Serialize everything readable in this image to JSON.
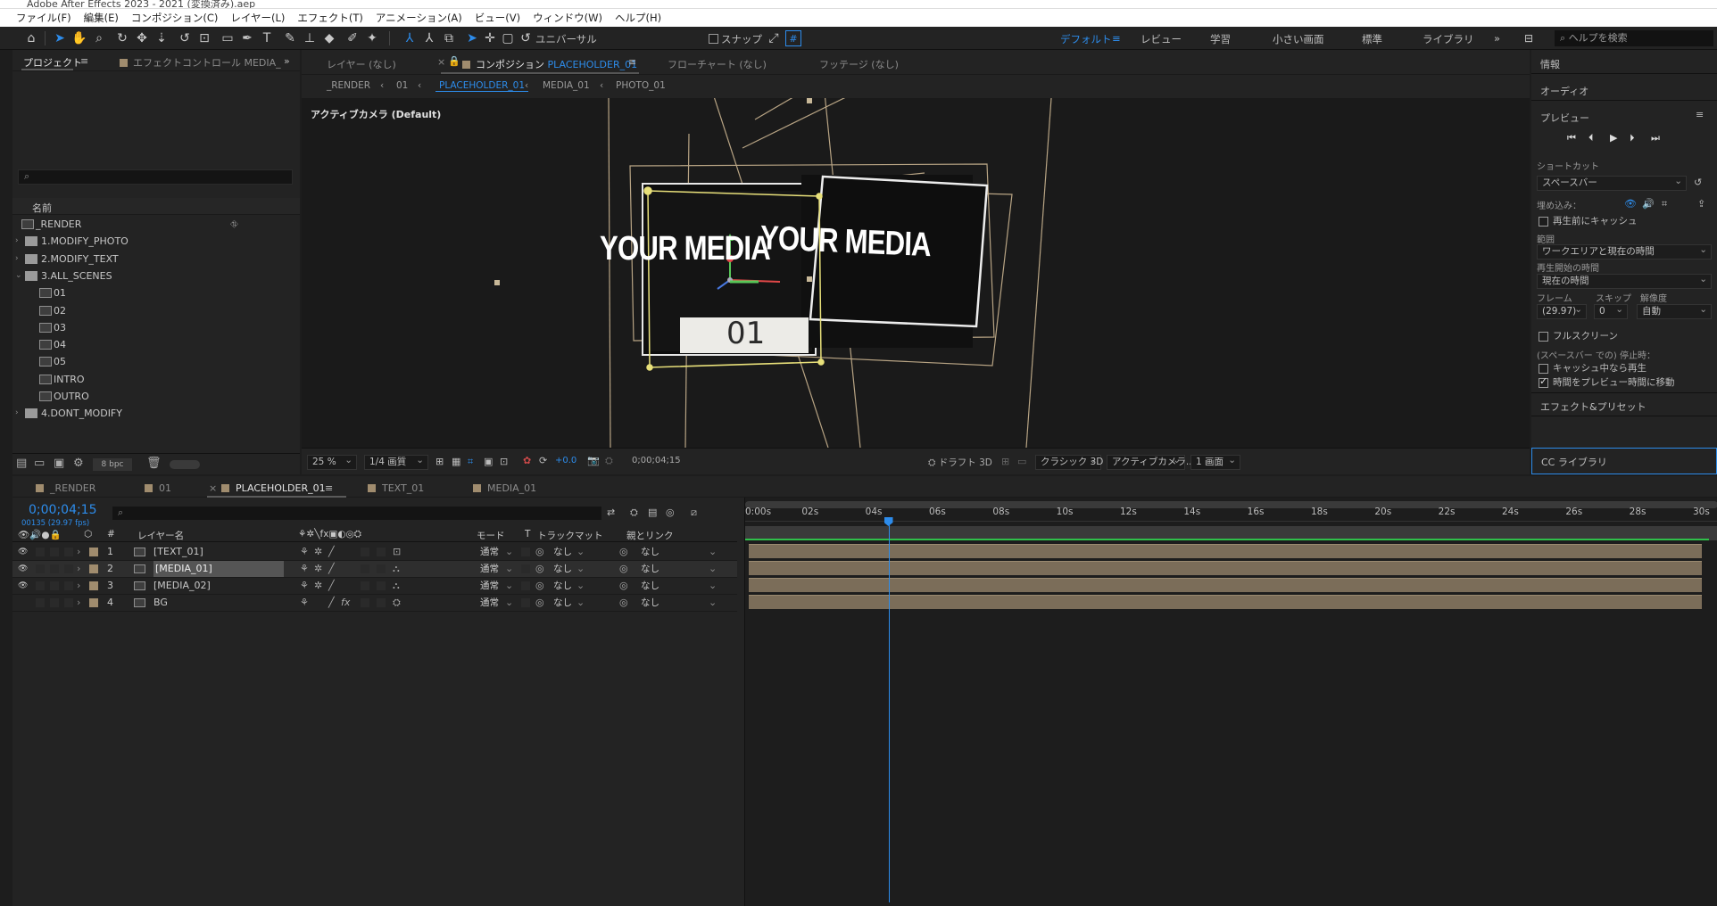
{
  "app": {
    "title": "Adobe After Effects 2023 - 2021 (変換済み).aep",
    "menu": [
      "ファイル(F)",
      "編集(E)",
      "コンポジション(C)",
      "レイヤー(L)",
      "エフェクト(T)",
      "アニメーション(A)",
      "ビュー(V)",
      "ウィンドウ(W)",
      "ヘルプ(H)"
    ]
  },
  "toolbar": {
    "universal": "ユニバーサル",
    "snap": "スナップ",
    "workspaces": [
      "デフォルト",
      "レビュー",
      "学習",
      "小さい画面",
      "標準",
      "ライブラリ"
    ],
    "active_workspace": "デフォルト",
    "search_placeholder": "ヘルプを検索"
  },
  "project": {
    "tabs": [
      "プロジェクト",
      "エフェクトコントロール MEDIA_"
    ],
    "search_placeholder": "",
    "column_name": "名前",
    "items": [
      {
        "label": "_RENDER",
        "type": "comp",
        "indent": 0
      },
      {
        "label": "1.MODIFY_PHOTO",
        "type": "folder",
        "indent": 0,
        "collapsed": true
      },
      {
        "label": "2.MODIFY_TEXT",
        "type": "folder",
        "indent": 0,
        "collapsed": true
      },
      {
        "label": "3.ALL_SCENES",
        "type": "folder",
        "indent": 0,
        "collapsed": false
      },
      {
        "label": "01",
        "type": "comp",
        "indent": 1
      },
      {
        "label": "02",
        "type": "comp",
        "indent": 1
      },
      {
        "label": "03",
        "type": "comp",
        "indent": 1
      },
      {
        "label": "04",
        "type": "comp",
        "indent": 1
      },
      {
        "label": "05",
        "type": "comp",
        "indent": 1
      },
      {
        "label": "INTRO",
        "type": "comp",
        "indent": 1
      },
      {
        "label": "OUTRO",
        "type": "comp",
        "indent": 1
      },
      {
        "label": "4.DONT_MODIFY",
        "type": "folder",
        "indent": 0,
        "collapsed": true
      }
    ],
    "bpc": "8 bpc"
  },
  "viewer": {
    "tabs": {
      "layer": "レイヤー (なし)",
      "comp_prefix": "コンポジション",
      "comp_name": "PLACEHOLDER_01",
      "flowchart": "フローチャート (なし)",
      "footage": "フッテージ (なし)"
    },
    "breadcrumbs": [
      "_RENDER",
      "01",
      "PLACEHOLDER_01",
      "MEDIA_01",
      "PHOTO_01"
    ],
    "active_breadcrumb": "PLACEHOLDER_01",
    "camera_label": "アクティブカメラ (Default)",
    "card_text_1": "YOUR MEDIA",
    "card_text_2": "YOUR MEDIA",
    "card_number": "01",
    "footer": {
      "zoom": "25 %",
      "quality": "1/4 画質",
      "exposure": "+0.0",
      "timecode": "0;00;04;15",
      "draft3d": "ドラフト 3D",
      "renderer": "クラシック 3D",
      "camera": "アクティブカメラ...",
      "views": "1 画面"
    }
  },
  "right_panel": {
    "info": "情報",
    "audio": "オーディオ",
    "preview": "プレビュー",
    "shortcut_label": "ショートカット",
    "shortcut_value": "スペースバー",
    "include_label": "埋め込み：",
    "cache_before": "再生前にキャッシュ",
    "range_label": "範囲",
    "range_value": "ワークエリアと現在の時間",
    "play_from_label": "再生開始の時間",
    "play_from_value": "現在の時間",
    "frame_label": "フレーム",
    "skip_label": "スキップ",
    "res_label": "解像度",
    "frame_value": "(29.97)",
    "skip_value": "0",
    "res_value": "自動",
    "fullscreen": "フルスクリーン",
    "stop_label": "(スペースバー での) 停止時：",
    "cache_in_play": "キャッシュ中なら再生",
    "move_time": "時間をプレビュー時間に移動",
    "effects_presets": "エフェクト&プリセット",
    "cc_libraries": "CC ライブラリ"
  },
  "timeline": {
    "tabs": [
      "_RENDER",
      "01",
      "PLACEHOLDER_01",
      "TEXT_01",
      "MEDIA_01"
    ],
    "active_tab": "PLACEHOLDER_01",
    "current_time": "0;00;04;15",
    "frame_info": "00135 (29.97 fps)",
    "columns": {
      "num": "#",
      "name": "レイヤー名",
      "mode": "モード",
      "t": "T",
      "matte": "トラックマット",
      "parent": "親とリンク"
    },
    "layers": [
      {
        "num": "1",
        "name": "[TEXT_01]",
        "mode": "通常",
        "matte": "なし",
        "parent": "なし",
        "selected": false,
        "fx": false
      },
      {
        "num": "2",
        "name": "[MEDIA_01]",
        "mode": "通常",
        "matte": "なし",
        "parent": "なし",
        "selected": true,
        "fx": false
      },
      {
        "num": "3",
        "name": "[MEDIA_02]",
        "mode": "通常",
        "matte": "なし",
        "parent": "なし",
        "selected": false,
        "fx": false
      },
      {
        "num": "4",
        "name": "BG",
        "mode": "通常",
        "matte": "なし",
        "parent": "なし",
        "selected": false,
        "fx": true
      }
    ],
    "ruler": [
      "0:00s",
      "02s",
      "04s",
      "06s",
      "08s",
      "10s",
      "12s",
      "14s",
      "16s",
      "18s",
      "20s",
      "22s",
      "24s",
      "26s",
      "28s",
      "30s"
    ],
    "playhead_seconds": 4.5,
    "duration_seconds": 30
  },
  "colors": {
    "accent": "#2d8ceb",
    "label_sand": "#a08c6e",
    "bar": "#7b6d59"
  }
}
